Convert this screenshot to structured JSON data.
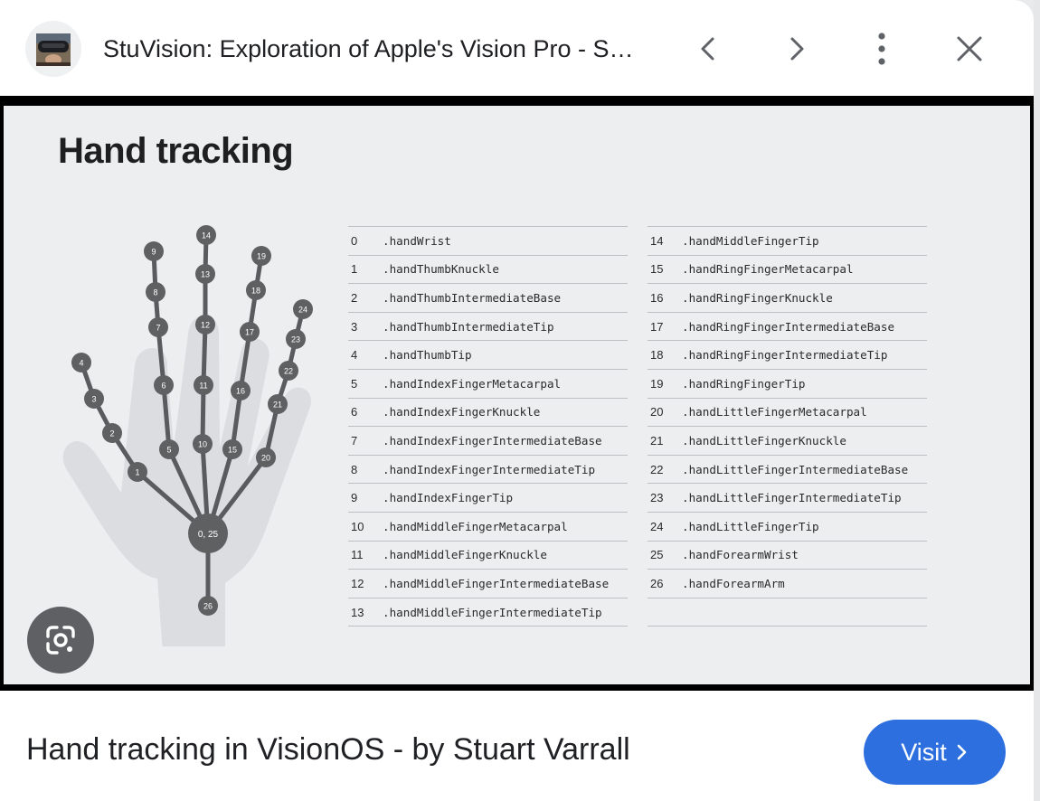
{
  "header": {
    "title": "StuVision: Exploration of Apple's Vision Pro - S…",
    "favicon_icon": "vision-pro-headset-avatar-icon",
    "back_icon": "chevron-left-icon",
    "forward_icon": "chevron-right-icon",
    "more_icon": "more-vert-icon",
    "close_icon": "close-icon"
  },
  "image": {
    "title": "Hand tracking",
    "hand_labels": [
      "0, 25",
      "1",
      "2",
      "3",
      "4",
      "5",
      "6",
      "7",
      "8",
      "9",
      "10",
      "11",
      "12",
      "13",
      "14",
      "15",
      "16",
      "17",
      "18",
      "19",
      "20",
      "21",
      "22",
      "23",
      "24",
      "26"
    ],
    "joints_left": [
      {
        "num": "0",
        "name": ".handWrist"
      },
      {
        "num": "1",
        "name": ".handThumbKnuckle"
      },
      {
        "num": "2",
        "name": ".handThumbIntermediateBase"
      },
      {
        "num": "3",
        "name": ".handThumbIntermediateTip"
      },
      {
        "num": "4",
        "name": ".handThumbTip"
      },
      {
        "num": "5",
        "name": ".handIndexFingerMetacarpal"
      },
      {
        "num": "6",
        "name": ".handIndexFingerKnuckle"
      },
      {
        "num": "7",
        "name": ".handIndexFingerIntermediateBase"
      },
      {
        "num": "8",
        "name": ".handIndexFingerIntermediateTip"
      },
      {
        "num": "9",
        "name": ".handIndexFingerTip"
      },
      {
        "num": "10",
        "name": ".handMiddleFingerMetacarpal"
      },
      {
        "num": "11",
        "name": ".handMiddleFingerKnuckle"
      },
      {
        "num": "12",
        "name": ".handMiddleFingerIntermediateBase"
      },
      {
        "num": "13",
        "name": ".handMiddleFingerIntermediateTip"
      }
    ],
    "joints_right": [
      {
        "num": "14",
        "name": ".handMiddleFingerTip"
      },
      {
        "num": "15",
        "name": ".handRingFingerMetacarpal"
      },
      {
        "num": "16",
        "name": ".handRingFingerKnuckle"
      },
      {
        "num": "17",
        "name": ".handRingFingerIntermediateBase"
      },
      {
        "num": "18",
        "name": ".handRingFingerIntermediateTip"
      },
      {
        "num": "19",
        "name": ".handRingFingerTip"
      },
      {
        "num": "20",
        "name": ".handLittleFingerMetacarpal"
      },
      {
        "num": "21",
        "name": ".handLittleFingerKnuckle"
      },
      {
        "num": "22",
        "name": ".handLittleFingerIntermediateBase"
      },
      {
        "num": "23",
        "name": ".handLittleFingerIntermediateTip"
      },
      {
        "num": "24",
        "name": ".handLittleFingerTip"
      },
      {
        "num": "25",
        "name": ".handForearmWrist"
      },
      {
        "num": "26",
        "name": ".handForearmArm"
      }
    ],
    "lens_icon": "google-lens-icon"
  },
  "footer": {
    "caption": "Hand tracking in VisionOS - by Stuart Varrall",
    "visit_label": "Visit",
    "visit_icon": "chevron-right-icon"
  },
  "colors": {
    "accent": "#2e6fe0",
    "node": "#5f6062",
    "hand_silhouette": "#dcdde0",
    "slide_bg": "#eceeef"
  }
}
